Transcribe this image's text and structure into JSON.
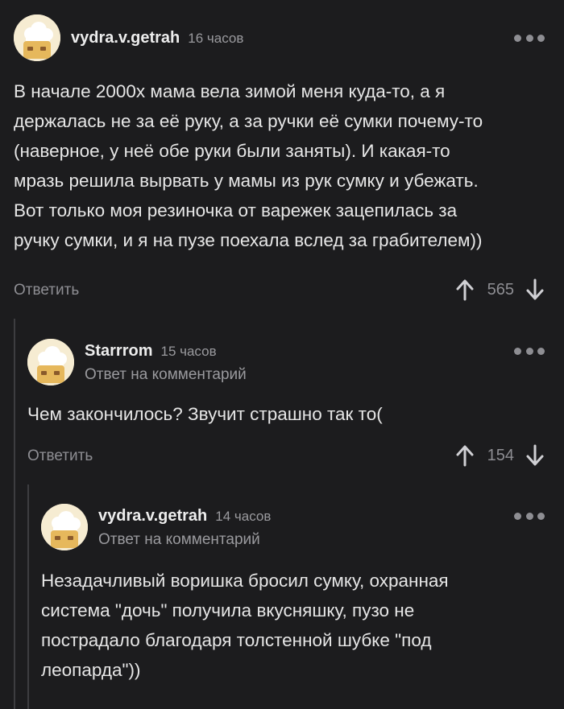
{
  "comments": [
    {
      "author": "vydra.v.getrah",
      "time": "16 часов",
      "text": "В начале 2000х мама вела зимой меня куда-то, а я\nдержалась не за её руку, а за ручки её сумки почему-то\n(наверное, у неё обе руки были заняты). И какая-то\nмразь решила вырвать у мамы из рук сумку и убежать.\nВот только моя резиночка от варежек зацепилась за\nручку сумки, и я на пузе поехала вслед за грабителем))",
      "reply_label": "Ответить",
      "rating": "565"
    },
    {
      "author": "Starrrom",
      "time": "15 часов",
      "subtitle": "Ответ на комментарий",
      "text": "Чем закончилось? Звучит страшно так то(",
      "reply_label": "Ответить",
      "rating": "154"
    },
    {
      "author": "vydra.v.getrah",
      "time": "14 часов",
      "subtitle": "Ответ на комментарий",
      "text": "Незадачливый воришка бросил сумку, охранная\nсистема \"дочь\" получила вкусняшку, пузо не\nпострадало благодаря толстенной шубке \"под\nлеопарда\"))"
    }
  ],
  "icons": {
    "avatar": "chef-hat-avatar-icon",
    "more": "more-dots-icon",
    "upvote": "arrow-up-icon",
    "downvote": "arrow-down-icon"
  },
  "colors": {
    "background": "#1c1c1e",
    "text": "#e6e6e6",
    "muted": "#8e8e93",
    "thread_line": "#3d3d40",
    "avatar_bg": "#f6ecd2"
  }
}
